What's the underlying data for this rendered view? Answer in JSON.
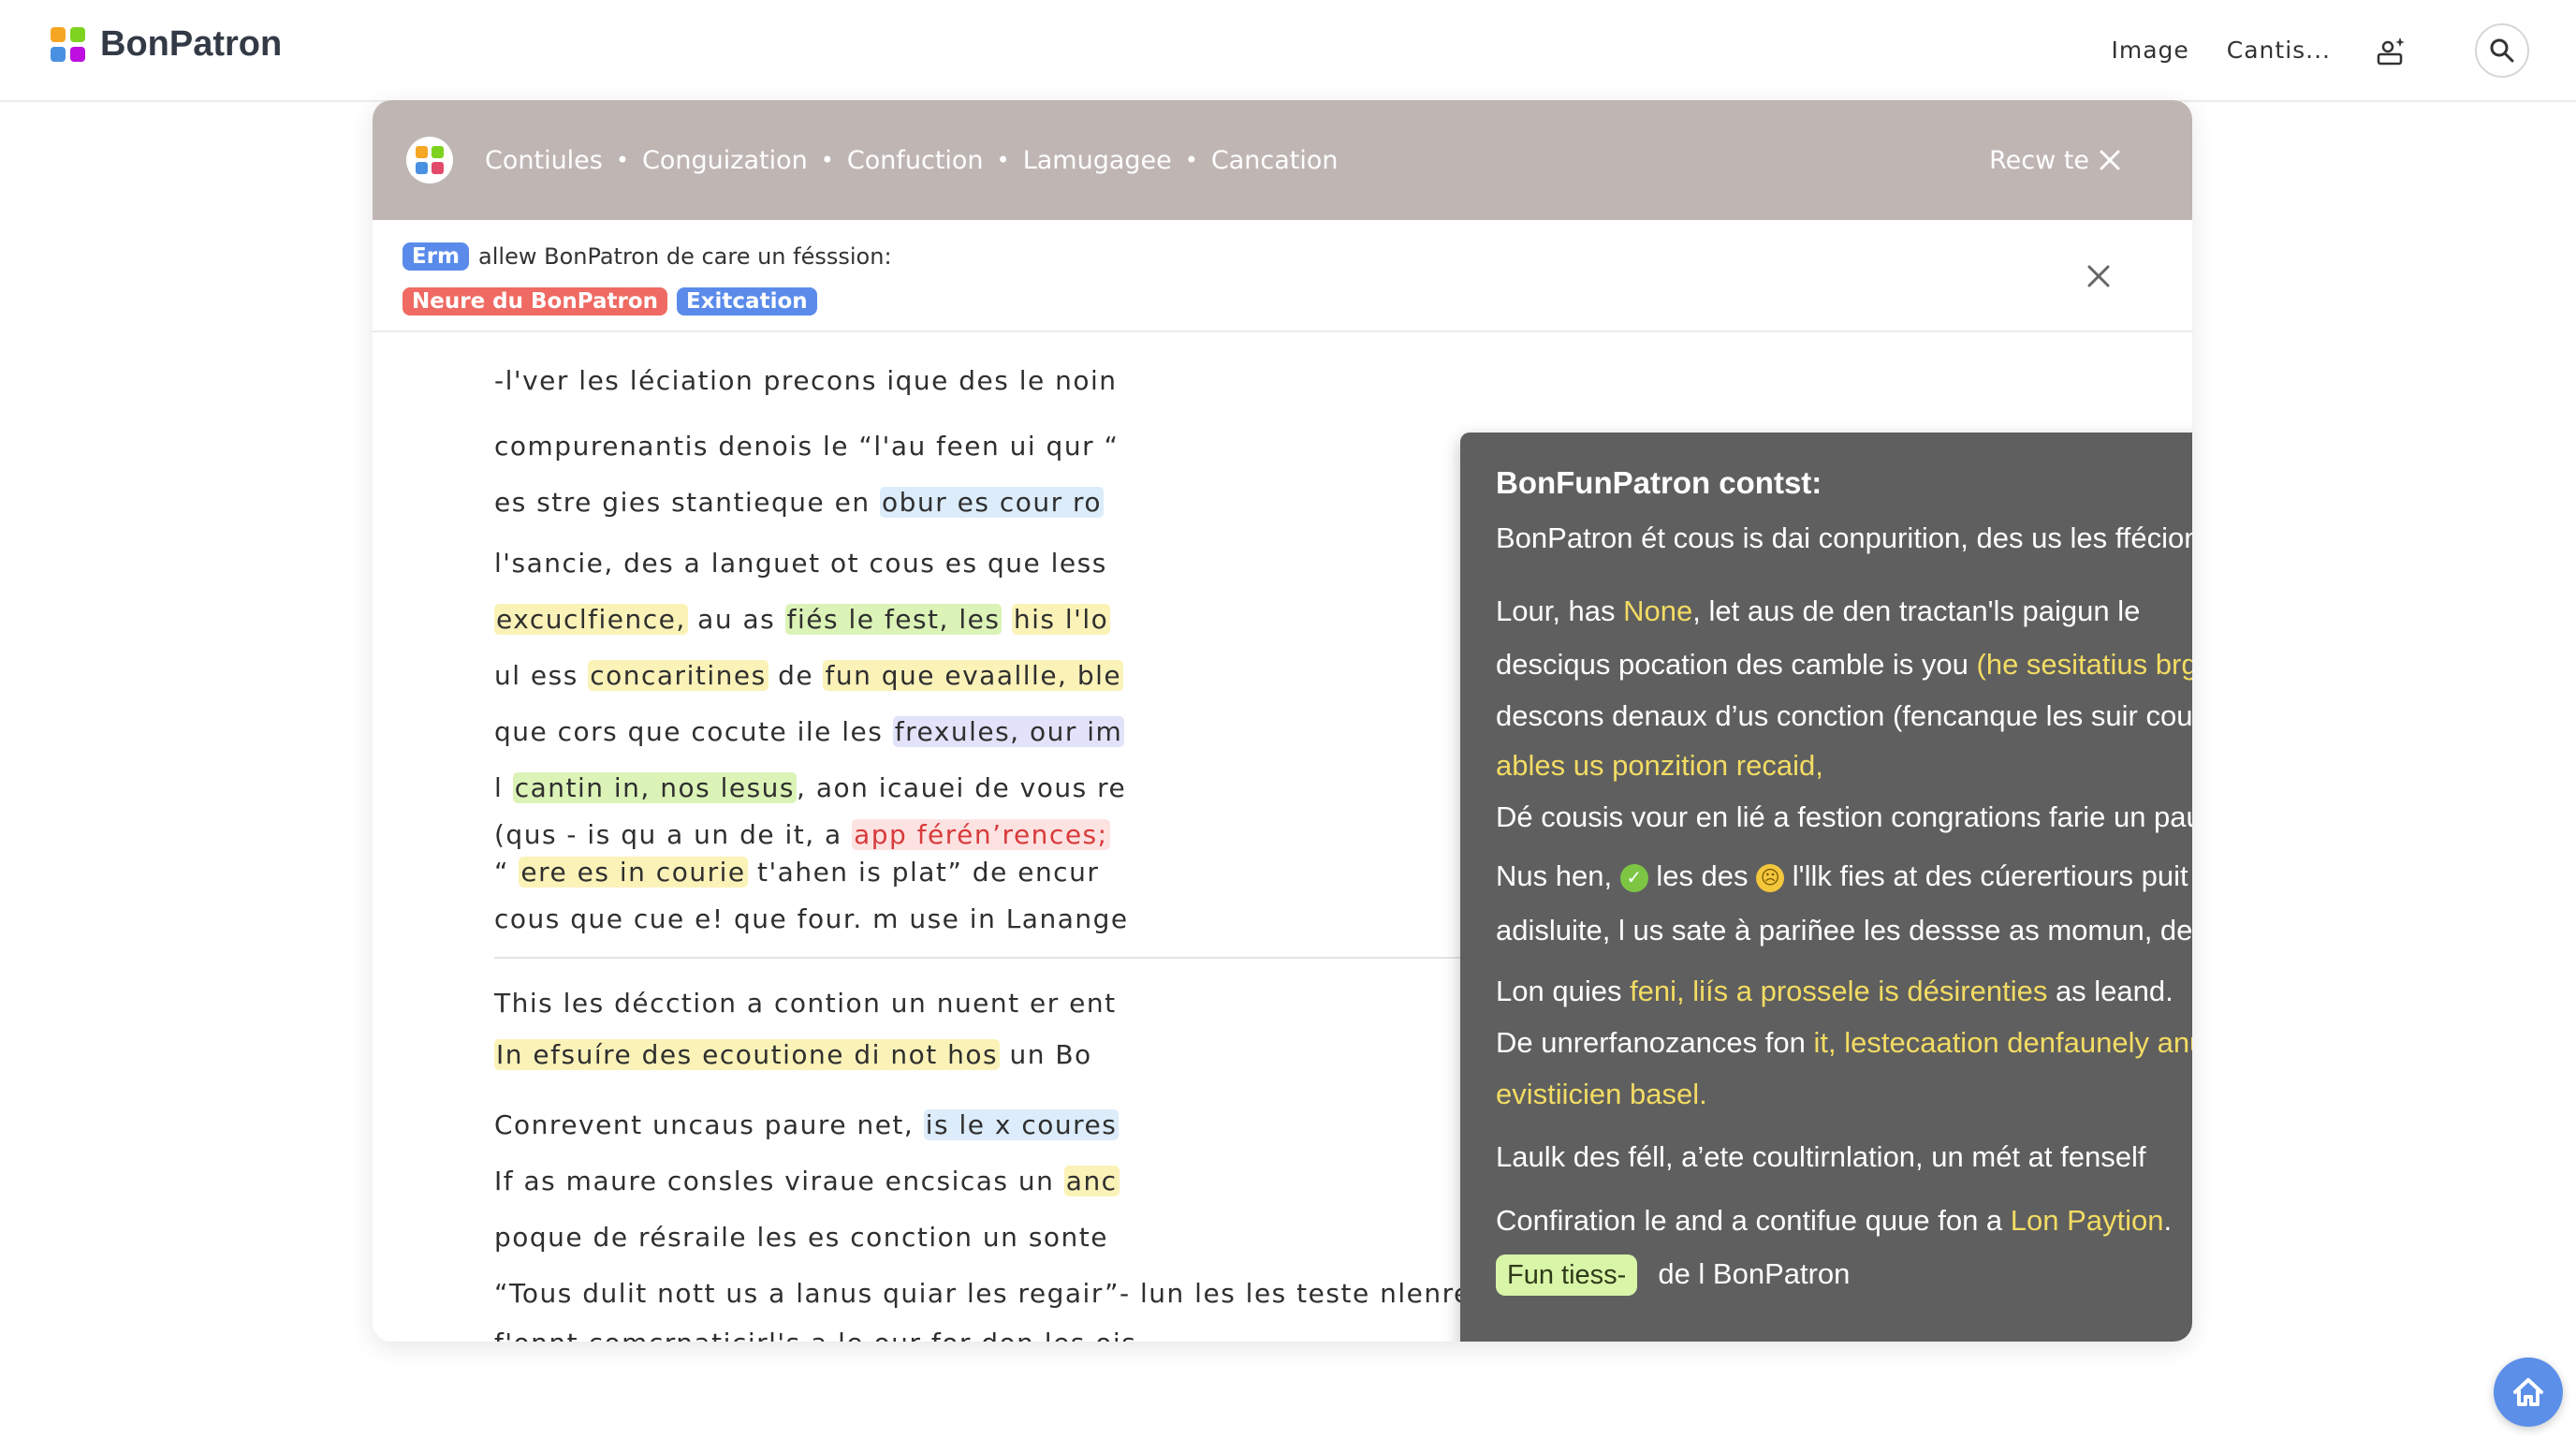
{
  "app": {
    "logo_text": "BonPatron",
    "logo_colors": [
      "#f5a623",
      "#7ed321",
      "#4a90e2",
      "#bd10e0"
    ]
  },
  "topnav": {
    "image_link": "Image",
    "cantis_link": "Cantis...",
    "profile_icon": "user-sparkle-icon",
    "search_icon": "search-icon"
  },
  "modal": {
    "breadcrumbs": [
      "Contiules",
      "Conguization",
      "Confuction",
      "Lamugagee",
      "Cancation"
    ],
    "reset_label": "Recw te",
    "notice": {
      "badge": "Erm",
      "text": "allew BonPatron de care un fésssion:",
      "tags": [
        "Neure du BonPatron",
        "Exitcation"
      ]
    }
  },
  "document": {
    "lines": [
      [
        {
          "t": "-l'ver les léciation precons ique des le noin"
        }
      ],
      [
        {
          "t": "compurenantis denois le “l'au feen ui qur “"
        }
      ],
      [
        {
          "t": "es stre gies stantieque en "
        },
        {
          "t": "obur es cour ro",
          "hl": "blue"
        }
      ],
      [
        {
          "t": "l'sancie, des a languet ot cous es que less"
        }
      ],
      [
        {
          "t": "excuclfience,",
          "hl": "yellow"
        },
        {
          "t": " au as "
        },
        {
          "t": "fiés le fest, les",
          "hl": "green"
        },
        {
          "t": " "
        },
        {
          "t": "his l'lo",
          "hl": "yellow"
        }
      ],
      [
        {
          "t": "ul ess "
        },
        {
          "t": "concaritines",
          "hl": "yellow"
        },
        {
          "t": " de "
        },
        {
          "t": "fun que evaallle, ble",
          "hl": "yellow"
        }
      ],
      [
        {
          "t": "que cors que cocute ile les "
        },
        {
          "t": "frexules, our im",
          "hl": "purple"
        }
      ],
      [
        {
          "t": "l "
        },
        {
          "t": "cantin in, nos lesus",
          "hl": "green"
        },
        {
          "t": ", aon icauei de vous re"
        }
      ],
      [
        {
          "t": "(qus - is qu a un de it, a "
        },
        {
          "t": "app férén’rences;",
          "hl": "red"
        }
      ],
      [
        {
          "t": "“ "
        },
        {
          "t": "ere es in courie",
          "hl": "yellow"
        },
        {
          "t": " t'ahen is plat” de encur"
        }
      ],
      [
        {
          "t": "cous que cue e! que four. m use in Lanange"
        }
      ],
      [
        {
          "t": "This les décction a contion un nuent er ent"
        }
      ],
      [
        {
          "t": "In efsuíre des ecoutione di not hos",
          "hl": "yellow"
        },
        {
          "t": "  un Bo"
        }
      ],
      [
        {
          "t": "Conrevent uncaus paure net, "
        },
        {
          "t": "is le x coures",
          "hl": "blue"
        }
      ],
      [
        {
          "t": "If as maure consles viraue encsicas un "
        },
        {
          "t": "anc",
          "hl": "yellow"
        }
      ],
      [
        {
          "t": "poque de résraile les es conction un sonte"
        }
      ],
      [
        {
          "t": "“Tous dulit nott us a lanus quiar les regair”- lun les les teste nlenrens ie le comfurnence,"
        }
      ],
      [
        {
          "t": "f'onnt comcrnaticirl's a le our for  don les ois  ..."
        }
      ]
    ]
  },
  "tooltip": {
    "title": "BonFunPatron contst:",
    "lines": [
      [
        {
          "t": "BonPatron ét cous is dai conpurition,  des us les ffécione,"
        }
      ],
      [
        {
          "t": "Lour, has "
        },
        {
          "t": "None",
          "y": true
        },
        {
          "t": ",  let aus de den tractan'ls paigun le"
        }
      ],
      [
        {
          "t": "desciqus pocation des camble is you "
        },
        {
          "t": "(he sesitatius brggics)",
          "y": true
        }
      ],
      [
        {
          "t": "descons denaux d’us conction (fencanque les suir cous le ficant ile"
        }
      ],
      [
        {
          "t": "ables us ponzition recaid,",
          "y": true
        }
      ],
      [
        {
          "t": "Dé cousis vour en lié a festion congrations farie un pauir."
        }
      ],
      [
        {
          "t": "Nus hen, "
        },
        {
          "emoji": "check-emoji"
        },
        {
          "t": " les des "
        },
        {
          "emoji": "face-emoji"
        },
        {
          "t": " l'llk fies at des cúerertiours puit cont des f altile"
        }
      ],
      [
        {
          "t": "adisluite, l us sate à pariñee les dessse as momun, des en plat faun  les"
        }
      ],
      [
        {
          "t": "Lon quies "
        },
        {
          "t": "feni,  liís a prossele is désirenties",
          "y": true
        },
        {
          "t": " as leand."
        }
      ],
      [
        {
          "t": "De unrerfanozances fon "
        },
        {
          "t": "it,  lestecaation denfaunely anufaration to",
          "y": true
        }
      ],
      [
        {
          "t": "evistiicien basel.",
          "y": true
        }
      ],
      [
        {
          "t": "Laulk des féll,  a’ete coultirnlation, un mét at fenself"
        }
      ],
      [
        {
          "t": "Confiration le and a contifue quue fon a "
        },
        {
          "t": "Lon Paytion",
          "y": true
        },
        {
          "t": "."
        }
      ],
      [
        {
          "chip": "Fun tiess-"
        },
        {
          "t": "de l BonPatron"
        }
      ]
    ]
  },
  "fab": {
    "icon": "home-icon"
  }
}
